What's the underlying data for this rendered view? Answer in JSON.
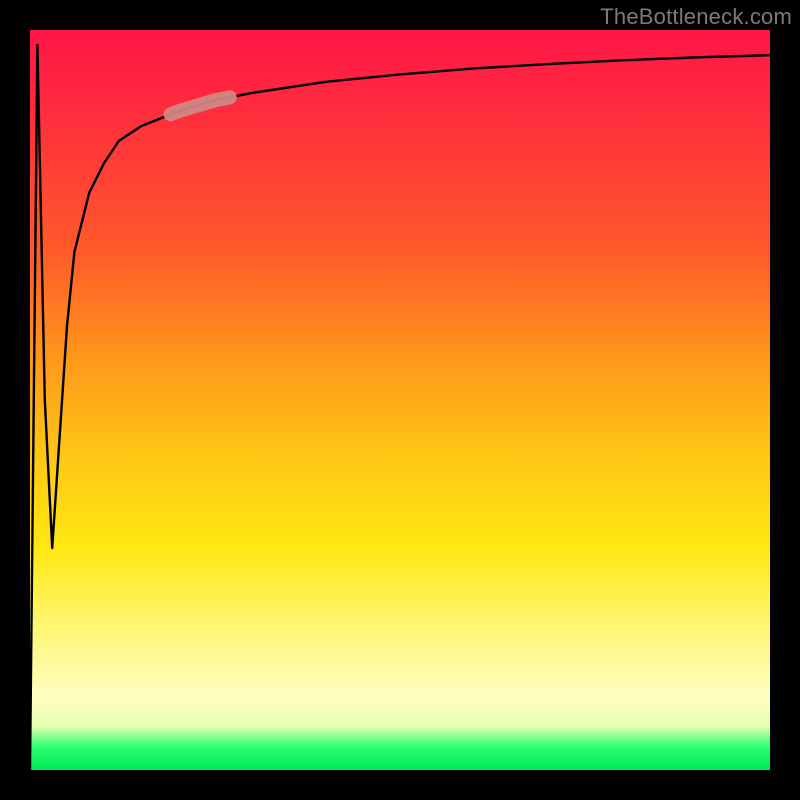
{
  "watermark": "TheBottleneck.com",
  "chart_data": {
    "type": "line",
    "title": "",
    "xlabel": "",
    "ylabel": "",
    "xlim": [
      0,
      100
    ],
    "ylim": [
      0,
      100
    ],
    "grid": false,
    "series": [
      {
        "name": "bottleneck-curve",
        "x": [
          0,
          1,
          2,
          3,
          4,
          5,
          6,
          8,
          10,
          12,
          15,
          20,
          25,
          30,
          40,
          50,
          60,
          70,
          80,
          90,
          100
        ],
        "values": [
          0,
          98,
          50,
          30,
          45,
          60,
          70,
          78,
          82,
          85,
          87,
          89,
          90.5,
          91.5,
          93,
          94,
          94.8,
          95.4,
          95.9,
          96.3,
          96.6
        ]
      }
    ],
    "annotations": [
      {
        "name": "highlight-segment",
        "on_series": "bottleneck-curve",
        "x_start": 19,
        "x_end": 27,
        "style": "thick-pink-overlay"
      }
    ],
    "background": {
      "type": "vertical-gradient",
      "stops": [
        {
          "pos": 0.0,
          "color": "#ff1646"
        },
        {
          "pos": 0.45,
          "color": "#ff9a1a"
        },
        {
          "pos": 0.7,
          "color": "#ffe812"
        },
        {
          "pos": 0.94,
          "color": "#e8ffb0"
        },
        {
          "pos": 1.0,
          "color": "#00e85a"
        }
      ]
    }
  }
}
